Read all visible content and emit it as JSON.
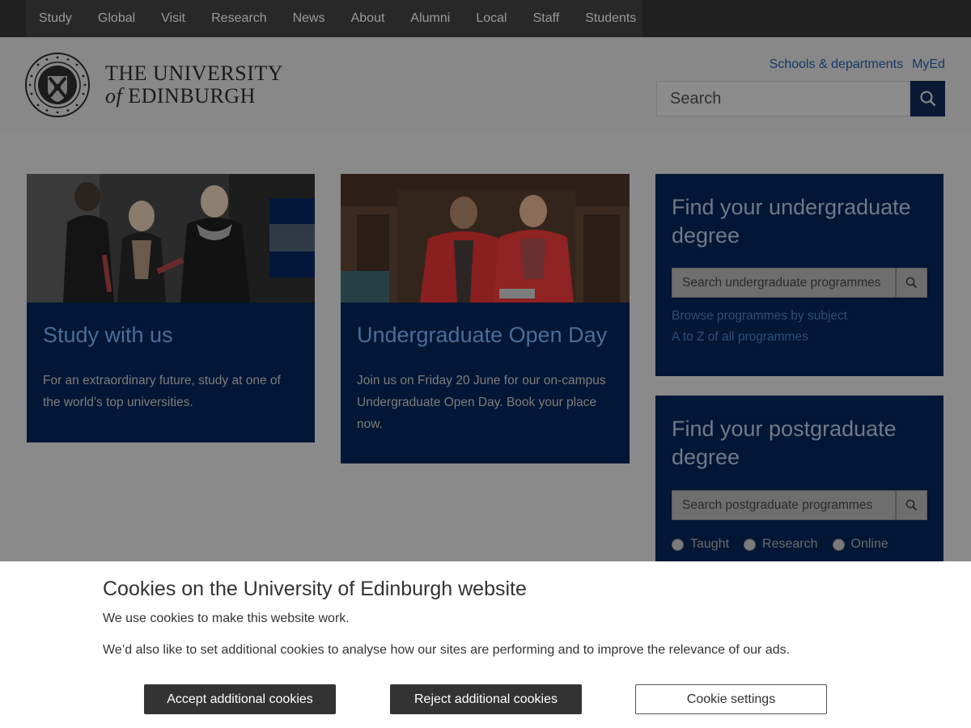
{
  "topnav": {
    "items": [
      "Study",
      "Global",
      "Visit",
      "Research",
      "News",
      "About",
      "Alumni",
      "Local",
      "Staff",
      "Students"
    ]
  },
  "header": {
    "logo": {
      "line1": "THE UNIVERSITY",
      "line2_of": "of",
      "line2_rest": "EDINBURGH"
    },
    "links": [
      "Schools & departments",
      "MyEd"
    ],
    "search": {
      "placeholder": "Search"
    }
  },
  "cards": [
    {
      "title": "Study with us",
      "body": "For an extraordinary future, study at one of the world’s top universities."
    },
    {
      "title": "Undergraduate Open Day",
      "body": "Join us on Friday 20 June for our on-campus Undergraduate Open Day. Book your place now."
    }
  ],
  "finder_ug": {
    "title": "Find your undergraduate degree",
    "search_placeholder": "Search undergraduate programmes",
    "links": [
      "Browse programmes by subject",
      "A to Z of all programmes"
    ]
  },
  "finder_pg": {
    "title": "Find your postgraduate degree",
    "search_placeholder": "Search postgraduate programmes",
    "options": [
      "Taught",
      "Research",
      "Online"
    ]
  },
  "cookie": {
    "title": "Cookies on the University of Edinburgh website",
    "p1": "We use cookies to make this website work.",
    "p2": "We’d also like to set additional cookies to analyse how our sites are performing and to improve the relevance of our ads.",
    "accept": "Accept additional cookies",
    "reject": "Reject additional cookies",
    "settings": "Cookie settings"
  },
  "colors": {
    "overlay_bg": "#8a8a8a",
    "nav_bg": "#202020",
    "card_bg": "#021635",
    "search_btn": "#0a1a34"
  }
}
